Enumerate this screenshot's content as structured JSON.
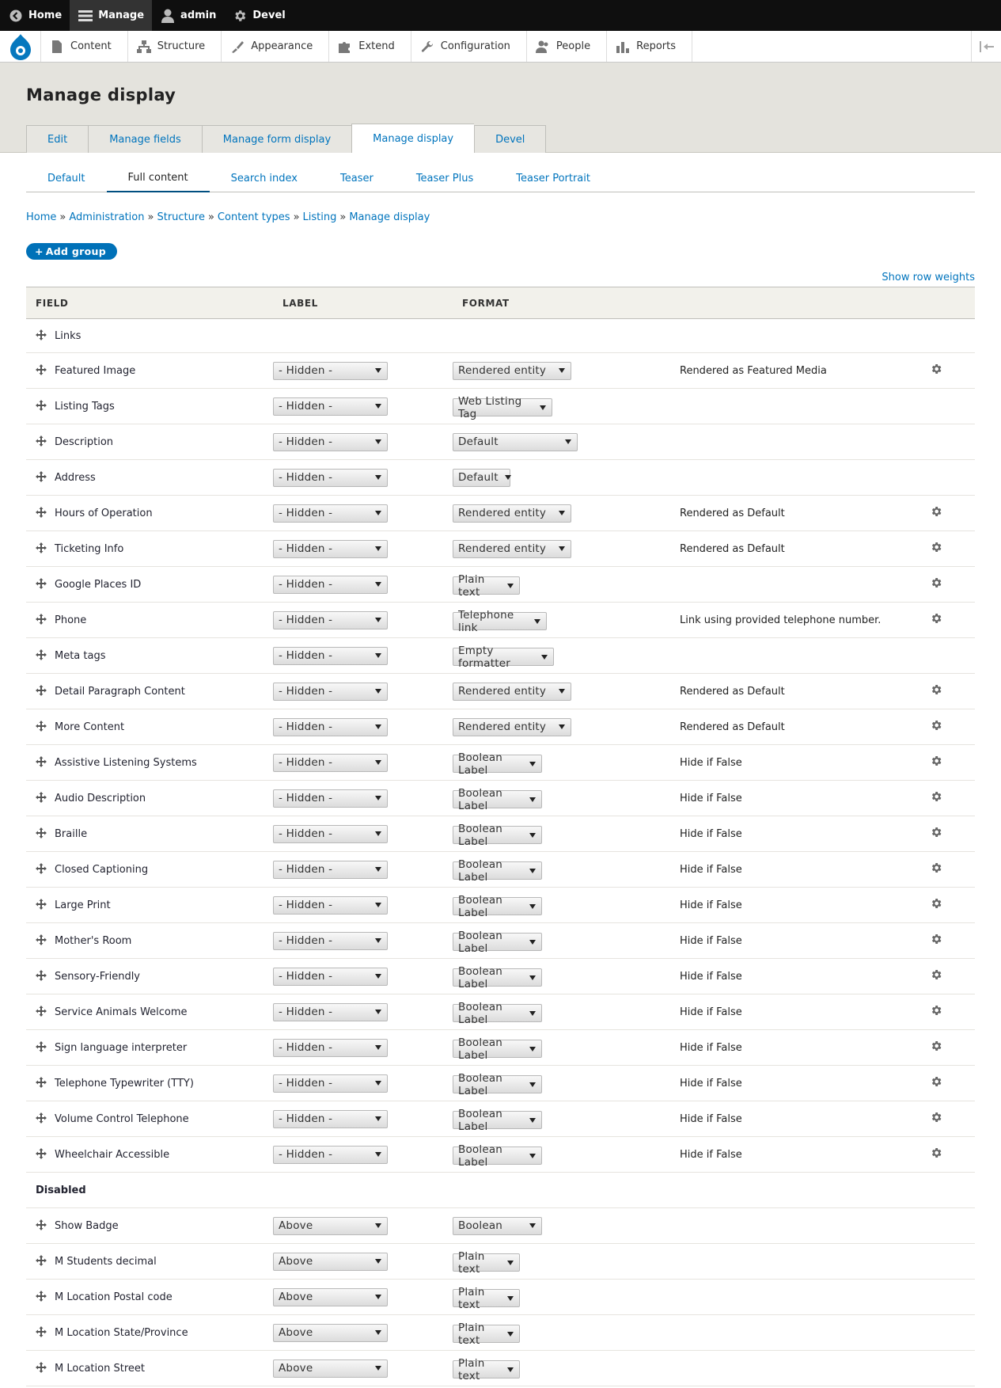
{
  "toolbar": {
    "home": "Home",
    "manage": "Manage",
    "user": "admin",
    "devel": "Devel"
  },
  "admin_menu": [
    "Content",
    "Structure",
    "Appearance",
    "Extend",
    "Configuration",
    "People",
    "Reports"
  ],
  "page_title": "Manage display",
  "primary_tabs": [
    "Edit",
    "Manage fields",
    "Manage form display",
    "Manage display",
    "Devel"
  ],
  "secondary_tabs": [
    "Default",
    "Full content",
    "Search index",
    "Teaser",
    "Teaser Plus",
    "Teaser Portrait"
  ],
  "breadcrumb": [
    "Home",
    "Administration",
    "Structure",
    "Content types",
    "Listing",
    "Manage display"
  ],
  "breadcrumb_separator": "»",
  "add_group": "Add group",
  "show_row_weights": "Show row weights",
  "table": {
    "headers": [
      "FIELD",
      "LABEL",
      "FORMAT"
    ],
    "links_row": "Links",
    "rows": [
      {
        "field": "Featured Image",
        "label": "- Hidden -",
        "format": "Rendered entity",
        "summary": "Rendered as Featured Media",
        "gear": true
      },
      {
        "field": "Listing Tags",
        "label": "- Hidden -",
        "format": "Web Listing Tag",
        "summary": "",
        "gear": false
      },
      {
        "field": "Description",
        "label": "- Hidden -",
        "format": "Default",
        "summary": "",
        "gear": false
      },
      {
        "field": "Address",
        "label": "- Hidden -",
        "format": "Default",
        "summary": "",
        "gear": false
      },
      {
        "field": "Hours of Operation",
        "label": "- Hidden -",
        "format": "Rendered entity",
        "summary": "Rendered as Default",
        "gear": true
      },
      {
        "field": "Ticketing Info",
        "label": "- Hidden -",
        "format": "Rendered entity",
        "summary": "Rendered as Default",
        "gear": true
      },
      {
        "field": "Google Places ID",
        "label": "- Hidden -",
        "format": "Plain text",
        "summary": "",
        "gear": true
      },
      {
        "field": "Phone",
        "label": "- Hidden -",
        "format": "Telephone link",
        "summary": "Link using provided telephone number.",
        "gear": true
      },
      {
        "field": "Meta tags",
        "label": "- Hidden -",
        "format": "Empty formatter",
        "summary": "",
        "gear": false
      },
      {
        "field": "Detail Paragraph Content",
        "label": "- Hidden -",
        "format": "Rendered entity",
        "summary": "Rendered as Default",
        "gear": true
      },
      {
        "field": "More Content",
        "label": "- Hidden -",
        "format": "Rendered entity",
        "summary": "Rendered as Default",
        "gear": true
      },
      {
        "field": "Assistive Listening Systems",
        "label": "- Hidden -",
        "format": "Boolean Label",
        "summary": "Hide if False",
        "gear": true
      },
      {
        "field": "Audio Description",
        "label": "- Hidden -",
        "format": "Boolean Label",
        "summary": "Hide if False",
        "gear": true
      },
      {
        "field": "Braille",
        "label": "- Hidden -",
        "format": "Boolean Label",
        "summary": "Hide if False",
        "gear": true
      },
      {
        "field": "Closed Captioning",
        "label": "- Hidden -",
        "format": "Boolean Label",
        "summary": "Hide if False",
        "gear": true
      },
      {
        "field": "Large Print",
        "label": "- Hidden -",
        "format": "Boolean Label",
        "summary": "Hide if False",
        "gear": true
      },
      {
        "field": "Mother's Room",
        "label": "- Hidden -",
        "format": "Boolean Label",
        "summary": "Hide if False",
        "gear": true
      },
      {
        "field": "Sensory-Friendly",
        "label": "- Hidden -",
        "format": "Boolean Label",
        "summary": "Hide if False",
        "gear": true
      },
      {
        "field": "Service Animals Welcome",
        "label": "- Hidden -",
        "format": "Boolean Label",
        "summary": "Hide if False",
        "gear": true
      },
      {
        "field": "Sign language interpreter",
        "label": "- Hidden -",
        "format": "Boolean Label",
        "summary": "Hide if False",
        "gear": true
      },
      {
        "field": "Telephone Typewriter (TTY)",
        "label": "- Hidden -",
        "format": "Boolean Label",
        "summary": "Hide if False",
        "gear": true
      },
      {
        "field": "Volume Control Telephone",
        "label": "- Hidden -",
        "format": "Boolean Label",
        "summary": "Hide if False",
        "gear": true
      },
      {
        "field": "Wheelchair Accessible",
        "label": "- Hidden -",
        "format": "Boolean Label",
        "summary": "Hide if False",
        "gear": true
      }
    ],
    "disabled_region": "Disabled",
    "disabled_rows": [
      {
        "field": "Show Badge",
        "label": "Above",
        "format": "Boolean"
      },
      {
        "field": "M Students decimal",
        "label": "Above",
        "format": "Plain text"
      },
      {
        "field": "M Location Postal code",
        "label": "Above",
        "format": "Plain text"
      },
      {
        "field": "M Location State/Province",
        "label": "Above",
        "format": "Plain text"
      },
      {
        "field": "M Location Street",
        "label": "Above",
        "format": "Plain text"
      }
    ]
  },
  "icons": {
    "drag": "drag-handle-icon",
    "settings": "gear-icon",
    "logo": "drupal-logo-icon"
  }
}
